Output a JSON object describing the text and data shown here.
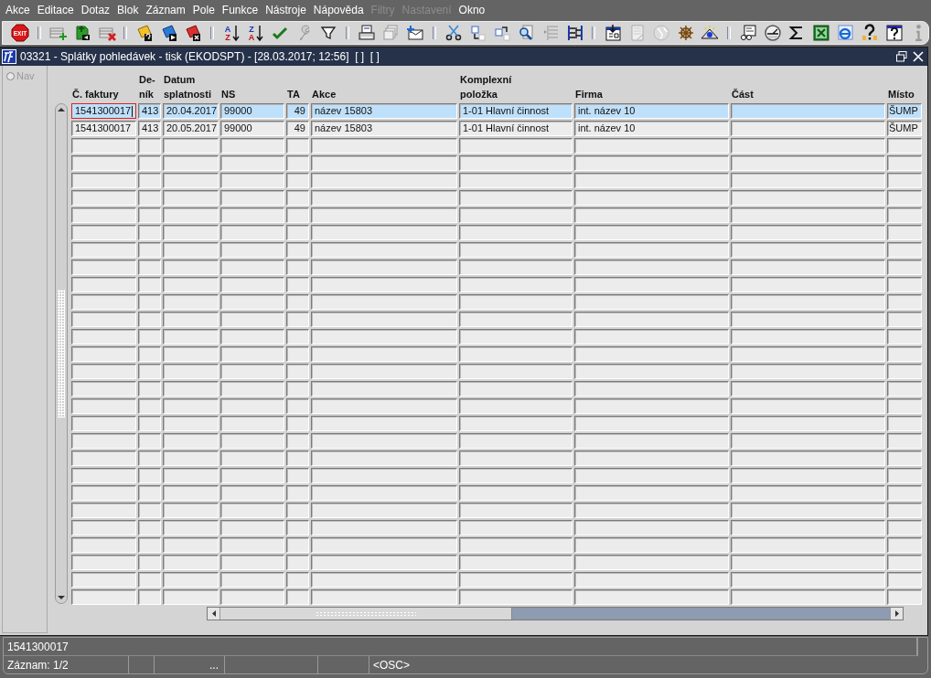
{
  "menu": [
    {
      "label": "Akce",
      "disabled": false
    },
    {
      "label": "Editace",
      "disabled": false
    },
    {
      "label": "Dotaz",
      "disabled": false
    },
    {
      "label": "Blok",
      "disabled": false
    },
    {
      "label": "Záznam",
      "disabled": false
    },
    {
      "label": "Pole",
      "disabled": false
    },
    {
      "label": "Funkce",
      "disabled": false
    },
    {
      "label": "Nástroje",
      "disabled": false
    },
    {
      "label": "Nápověda",
      "disabled": false
    },
    {
      "label": "Filtry",
      "disabled": true
    },
    {
      "label": "Nastavení",
      "disabled": true
    },
    {
      "label": "Okno",
      "disabled": false
    }
  ],
  "toolbar": {
    "exit_label": "EXIT",
    "sort_ascending": [
      "A",
      "Z"
    ],
    "sort_descending": [
      "Z",
      "A"
    ]
  },
  "window": {
    "title": "03321 - Splátky pohledávek - tisk (EKODSPT) - [28.03.2017; 12:56]  [ ]  [ ]"
  },
  "nav": {
    "label": "Nav",
    "checked": false,
    "disabled": true
  },
  "table": {
    "columns": [
      {
        "label": "Č. faktury"
      },
      {
        "label": "De-\nník"
      },
      {
        "label": "Datum\nsplatnosti"
      },
      {
        "label": "NS"
      },
      {
        "label": "TA"
      },
      {
        "label": "Akce"
      },
      {
        "label": "Komplexní\npoložka"
      },
      {
        "label": "Firma"
      },
      {
        "label": "Část"
      },
      {
        "label": "Místo"
      }
    ],
    "rows": [
      {
        "selected": true,
        "cells": [
          {
            "text": "1541300017",
            "focused": true
          },
          {
            "text": "413",
            "focused": false
          },
          {
            "text": "20.04.2017",
            "focused": false
          },
          {
            "text": "99000",
            "focused": false
          },
          {
            "text": "49",
            "focused": false
          },
          {
            "text": "název 15803",
            "focused": false
          },
          {
            "text": "1-01 Hlavní činnost",
            "focused": false
          },
          {
            "text": "int. název 10",
            "focused": false
          },
          {
            "text": "",
            "focused": false
          },
          {
            "text": "ŠUMP",
            "focused": false
          }
        ]
      },
      {
        "selected": false,
        "cells": [
          {
            "text": "1541300017",
            "focused": false
          },
          {
            "text": "413",
            "focused": false
          },
          {
            "text": "20.05.2017",
            "focused": false
          },
          {
            "text": "99000",
            "focused": false
          },
          {
            "text": "49",
            "focused": false
          },
          {
            "text": "název 15803",
            "focused": false
          },
          {
            "text": "1-01 Hlavní činnost",
            "focused": false
          },
          {
            "text": "int. název 10",
            "focused": false
          },
          {
            "text": "",
            "focused": false
          },
          {
            "text": "ŠUMP",
            "focused": false
          }
        ]
      }
    ]
  },
  "status_bar": {
    "field_value": "1541300017",
    "record": "Záznam: 1/2",
    "ellipsis": "...",
    "mode": "<OSC>"
  }
}
